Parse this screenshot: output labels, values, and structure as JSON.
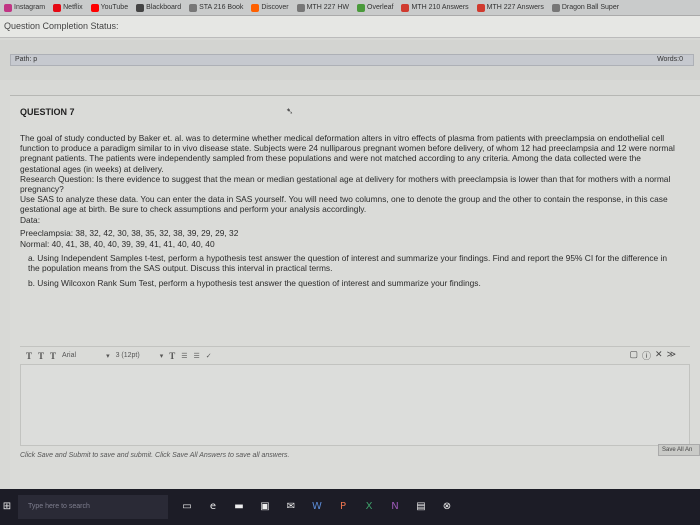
{
  "bookmarks": [
    {
      "label": "Instagram",
      "color": "#c13584"
    },
    {
      "label": "Netflix",
      "color": "#e50914"
    },
    {
      "label": "YouTube",
      "color": "#ff0000"
    },
    {
      "label": "Blackboard",
      "color": "#444444"
    },
    {
      "label": "STA 216 Book",
      "color": "#777777"
    },
    {
      "label": "Discover",
      "color": "#ff6000"
    },
    {
      "label": "MTH 227 HW",
      "color": "#777777"
    },
    {
      "label": "Overleaf",
      "color": "#4a9a3b"
    },
    {
      "label": "MTH 210 Answers",
      "color": "#d03a2e"
    },
    {
      "label": "MTH 227 Answers",
      "color": "#d03a2e"
    },
    {
      "label": "Dragon Ball Super",
      "color": "#777777"
    }
  ],
  "status": {
    "label": "Question Completion Status:"
  },
  "editor_top": {
    "path_label": "Path: p",
    "words_label": "Words:0"
  },
  "question": {
    "title": "QUESTION 7",
    "paragraphs": [
      "The goal of study conducted by Baker et. al. was to determine whether medical deformation alters in vitro effects of plasma from patients with preeclampsia on endothelial cell function to produce a paradigm similar to in vivo disease state. Subjects were 24 nulliparous pregnant women before delivery, of whom 12 had preeclampsia and 12 were normal pregnant patients. The patients were independently sampled from these populations and were not matched according to any criteria. Among the data collected were the gestational ages (in weeks) at delivery.",
      "Research Question: Is there evidence to suggest that the mean or median gestational age at delivery for mothers with preeclampsia is lower than that for mothers with a normal pregnancy?",
      "Use SAS to analyze these data. You can enter the data in SAS yourself. You will need two columns, one to denote the group and the other to contain the response, in this case gestational age at birth. Be sure to check assumptions and perform your analysis accordingly.",
      "Data:",
      "Preeclampsia: 38, 32, 42, 30, 38, 35, 32, 38, 39, 29, 29, 32",
      "Normal: 40, 41, 38, 40, 40, 39, 39, 41, 41, 40, 40, 40",
      "a. Using Independent Samples t-test, perform a hypothesis test answer the question of interest and summarize your findings. Find and report the 95% CI for the difference in the population means from the SAS output. Discuss this interval in practical terms.",
      "b. Using Wilcoxon Rank Sum Test, perform a hypothesis test answer the question of interest and summarize your findings."
    ]
  },
  "toolbar": {
    "btn_t1": "T",
    "btn_t2": "T",
    "btn_t3": "T",
    "font": "Arial",
    "size": "3 (12pt)",
    "text_color_icon": "T",
    "list_icon": "☰",
    "ordered_list_icon": "☰"
  },
  "footer": {
    "instructions": "Click Save and Submit to save and submit. Click Save All Answers to save all answers.",
    "save_all": "Save All An"
  },
  "taskbar": {
    "search_placeholder": "Type here to search"
  }
}
